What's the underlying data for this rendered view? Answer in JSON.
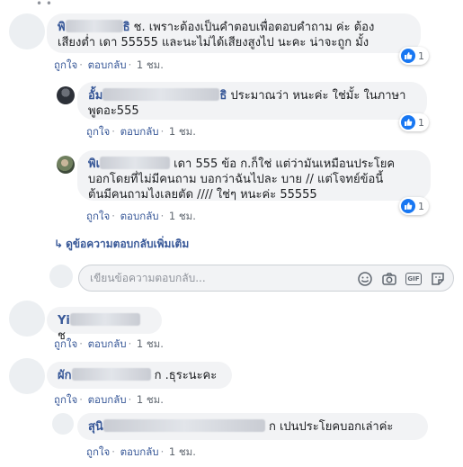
{
  "comments": [
    {
      "author_visible": "พิ",
      "author_suffix": "ธิ",
      "text_line1": "ช. เพราะต้องเป็นคำตอบเพื่อตอบคำถาม ค่ะ ต้อง",
      "text_line2": "เสียงต่ำ เดา 55555 และนะไม่ได้เสียงสูงไป นะคะ น่าจะถูก มั้ง",
      "like_label": "ถูกใจ",
      "reply_label": "ตอบกลับ",
      "time": "1 ชม.",
      "reaction_count": "1"
    },
    {
      "author_visible": "อั้ม",
      "author_suffix": "ธิ",
      "text_line1": "ประมาณว่า หนะค่ะ ใช่มั้ะ ในภาษา",
      "text_line2": "พูดอะ555",
      "like_label": "ถูกใจ",
      "reply_label": "ตอบกลับ",
      "time": "1 ชม.",
      "reaction_count": "1"
    },
    {
      "author_visible": "พิเ",
      "author_suffix": "",
      "text_line1": "เดา 555 ข้อ ก.ก็ใช่ แต่ว่ามันเหมือนประโยค",
      "text_line2": "บอกโดยที่ไม่มีคนถาม บอกว่าฉันไปละ บาย // แต่โจทย์ข้อนี้",
      "text_line3": "ต้นมีคนถามไงเลยตัด //// ใช่ๆ หนะค่ะ 55555",
      "like_label": "ถูกใจ",
      "reply_label": "ตอบกลับ",
      "time": "1 ชม.",
      "reaction_count": "1"
    },
    {
      "author_visible": "Yi",
      "author_suffix": "",
      "text_line1": "ช",
      "like_label": "ถูกใจ",
      "reply_label": "ตอบกลับ",
      "time": "1 ชม."
    },
    {
      "author_visible": "ผัก",
      "author_suffix": "",
      "text_line1": "ก .ธุระนะคะ",
      "like_label": "ถูกใจ",
      "reply_label": "ตอบกลับ",
      "time": "1 ชม."
    },
    {
      "author_visible": "สุนิ",
      "author_suffix": "",
      "text_line1": "ก เปนประโยคบอกเล่าค่ะ",
      "like_label": "ถูกใจ",
      "reply_label": "ตอบกลับ",
      "time": "1 ชม."
    }
  ],
  "more_replies_label": "ดูข้อความตอบกลับเพิ่มเติม",
  "reply_input": {
    "placeholder": "เขียนข้อความตอบกลับ..."
  },
  "icons": [
    "smiley-icon",
    "camera-icon",
    "gif-icon",
    "sticker-icon",
    "like-icon"
  ],
  "colors": {
    "link": "#385898",
    "bubble": "#f2f3f5",
    "like_blue": "#1877f2"
  }
}
